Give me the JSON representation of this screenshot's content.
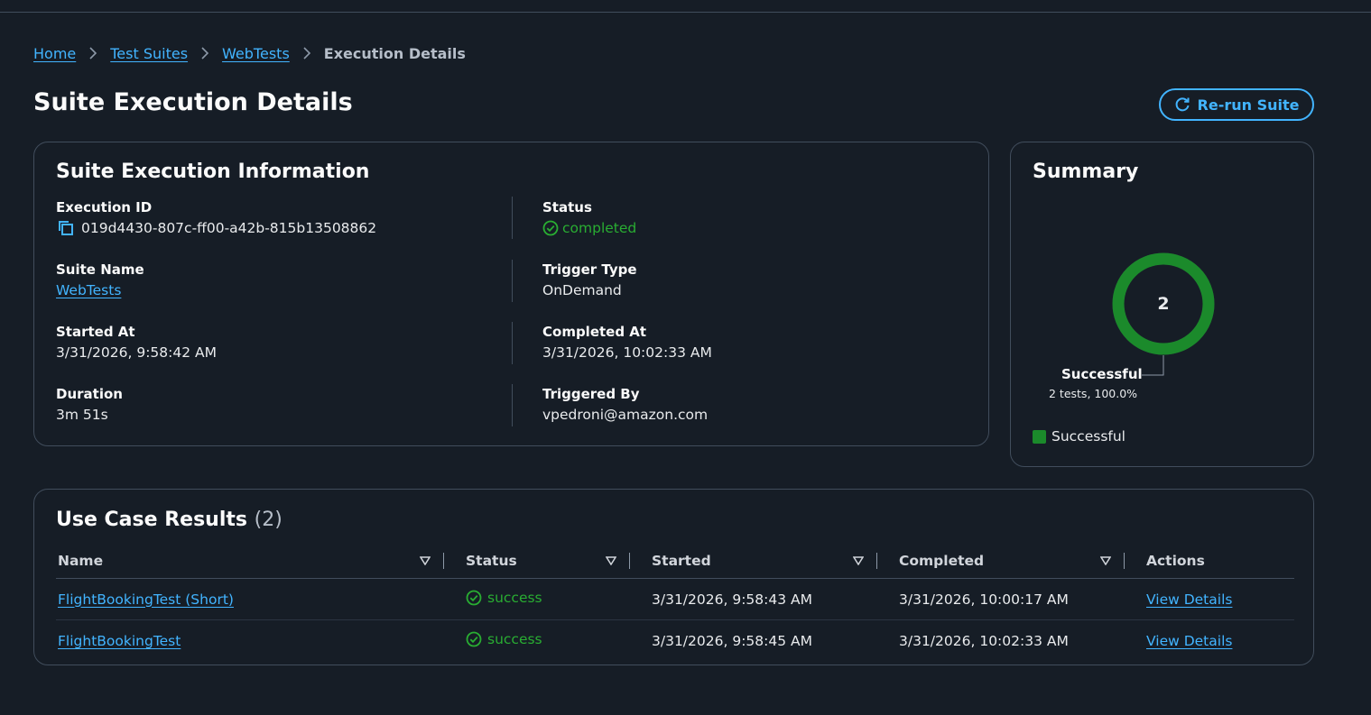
{
  "breadcrumb": {
    "home": "Home",
    "suites": "Test Suites",
    "suite": "WebTests",
    "current": "Execution Details"
  },
  "page": {
    "title": "Suite Execution Details",
    "rerun_label": "Re-run Suite"
  },
  "info": {
    "title": "Suite Execution Information",
    "execution_id_label": "Execution ID",
    "execution_id": "019d4430-807c-ff00-a42b-815b13508862",
    "status_label": "Status",
    "status": "completed",
    "suite_name_label": "Suite Name",
    "suite_name": "WebTests",
    "trigger_type_label": "Trigger Type",
    "trigger_type": "OnDemand",
    "started_at_label": "Started At",
    "started_at": "3/31/2026, 9:58:42 AM",
    "completed_at_label": "Completed At",
    "completed_at": "3/31/2026, 10:02:33 AM",
    "duration_label": "Duration",
    "duration": "3m 51s",
    "triggered_by_label": "Triggered By",
    "triggered_by": "vpedroni@amazon.com"
  },
  "summary": {
    "title": "Summary",
    "total": "2",
    "segment_label": "Successful",
    "segment_detail": "2 tests, 100.0%",
    "legend_label": "Successful",
    "success_fraction": 1.0,
    "success_color": "#1b8a2b"
  },
  "results": {
    "title": "Use Case Results",
    "count": "(2)",
    "columns": {
      "name": "Name",
      "status": "Status",
      "started": "Started",
      "completed": "Completed",
      "actions": "Actions"
    },
    "rows": [
      {
        "name": "FlightBookingTest (Short)",
        "status": "success",
        "started": "3/31/2026, 9:58:43 AM",
        "completed": "3/31/2026, 10:00:17 AM",
        "action": "View Details"
      },
      {
        "name": "FlightBookingTest",
        "status": "success",
        "started": "3/31/2026, 9:58:45 AM",
        "completed": "3/31/2026, 10:02:33 AM",
        "action": "View Details"
      }
    ]
  },
  "icons": {
    "separator": "chevron-right-icon",
    "copy": "copy-icon",
    "status_ok": "check-circle-icon",
    "refresh": "refresh-icon",
    "sort": "sort-caret-icon"
  }
}
